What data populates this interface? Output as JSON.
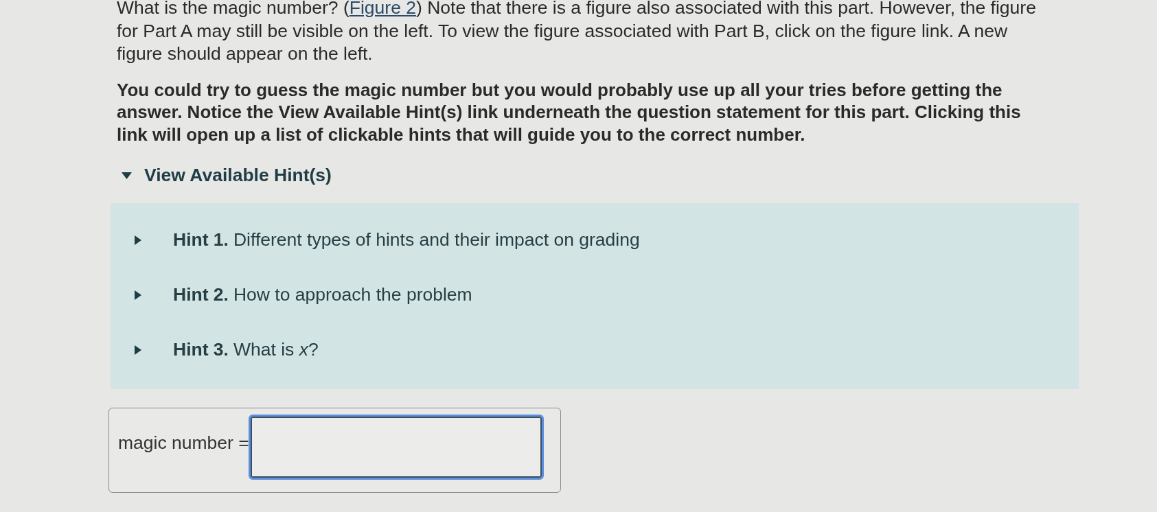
{
  "intro": {
    "before": "What is the magic number? (",
    "link": "Figure 2",
    "after": ") Note that there is a figure also associated with this part. However, the figure for Part A may still be visible on the left. To view the figure associated with Part B, click on the figure link. A new figure should appear on the left."
  },
  "instructions": "You could try to guess the magic number but you would probably use up all your tries before getting the answer. Notice the View Available Hint(s) link underneath the question statement for this part. Clicking this link will open up a list of clickable hints that will guide you to the correct number.",
  "hints_toggle": {
    "label": "View Available Hint(s)",
    "expanded": true
  },
  "hints": [
    {
      "title": "Hint 1.",
      "text": "Different types of hints and their impact on grading",
      "expanded": false
    },
    {
      "title": "Hint 2.",
      "text": "How to approach the problem",
      "expanded": false
    },
    {
      "title": "Hint 3.",
      "text": "What is *x*?",
      "expanded": false
    }
  ],
  "answer": {
    "label": "magic number =",
    "focused": true
  }
}
